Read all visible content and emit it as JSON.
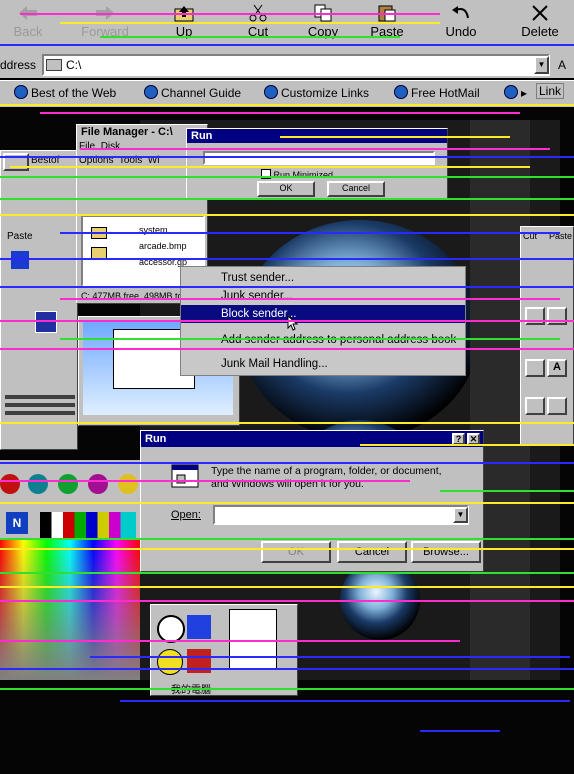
{
  "toolbar": {
    "items": [
      {
        "label": "Back",
        "state": "disabled"
      },
      {
        "label": "Forward",
        "state": "disabled"
      },
      {
        "label": "Up",
        "state": "enabled"
      },
      {
        "label": "Cut",
        "state": "enabled"
      },
      {
        "label": "Copy",
        "state": "enabled"
      },
      {
        "label": "Paste",
        "state": "enabled"
      },
      {
        "label": "Undo",
        "state": "enabled"
      },
      {
        "label": "Delete",
        "state": "enabled"
      }
    ]
  },
  "address": {
    "label": "ddress",
    "value": "C:\\",
    "right_fragment": "A"
  },
  "links": {
    "items": [
      "Best of the Web",
      "Channel Guide",
      "Customize Links",
      "Free HotMail"
    ],
    "overflow": "Link"
  },
  "file_manager": {
    "title": "File Manager - C:\\",
    "menu": [
      "File",
      "Disk",
      "Options",
      "Tools",
      "Wi"
    ],
    "files": [
      "system",
      "arcade.bmp",
      "accessor.gp"
    ],
    "status": "C: 477MB free, 498MB total"
  },
  "run_small": {
    "title": "Run",
    "checkbox": "Run Minimized",
    "ok": "OK",
    "cancel": "Cancel"
  },
  "context_menu": {
    "items": [
      {
        "label": "Trust sender..."
      },
      {
        "label": "Junk sender..."
      },
      {
        "label": "Block sender...",
        "selected": true
      },
      {
        "label": "Add sender address to personal address book"
      },
      {
        "label": "Junk Mail Handling..."
      }
    ]
  },
  "run_dialog": {
    "title": "Run",
    "prompt": "Type the name of a program, folder, or document, and Windows will open it for you.",
    "open_label": "Open:",
    "open_value": "",
    "ok": "OK",
    "cancel": "Cancel",
    "browse": "Browse..."
  },
  "left_panel": {
    "label_a": "Paste",
    "label_b": "Bestof"
  },
  "right_panel": {
    "label_cut": "Cut",
    "label_paste": "Paste"
  },
  "bottom_caption": "我的電腦",
  "colors": {
    "titlebar": "#000080",
    "face": "#c0c0c0",
    "selection": "#0a0a80"
  }
}
